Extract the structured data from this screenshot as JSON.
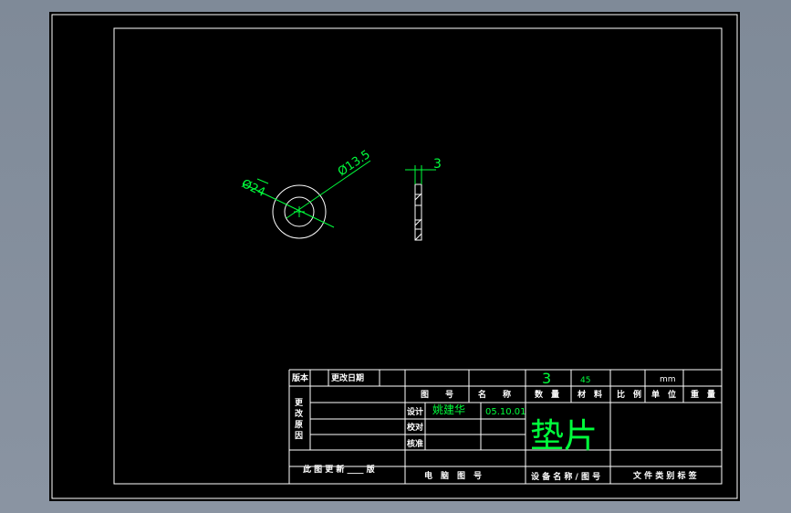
{
  "drawing": {
    "part_dims": {
      "outer_diameter": "Ø24",
      "inner_diameter": "Ø13.5",
      "thickness": "3"
    }
  },
  "title_block": {
    "version_label": "版本",
    "change_date_label": "更改日期",
    "change_label": "更\n改\n原\n因",
    "change_label_chars": [
      "更",
      "改",
      "原",
      "因"
    ],
    "update_label": "此 图 更 新 ____ 版",
    "drawing_no_header": "图　　号",
    "name_header": "名　　称",
    "qty_value": "3",
    "material_value": "45",
    "unit_value": "mm",
    "qty_header": "数　量",
    "material_header": "材　料",
    "scale_header": "比　例",
    "unit_header": "单　位",
    "weight_header": "重　量",
    "design_label": "设计",
    "designer_name": "姚建华",
    "design_date": "05.10.01",
    "check_label": "校对",
    "approve_label": "核准",
    "part_name": "垫片",
    "computer_no_label": "电　脑　图　号",
    "equipment_label": "设 备 名 称 / 图 号",
    "file_type_label": "文 件 类 别 标 签"
  },
  "colors": {
    "background": "#000000",
    "window_bg": "#8a94a2",
    "line_white": "#ffffff",
    "annotation_green": "#00ff3c"
  }
}
